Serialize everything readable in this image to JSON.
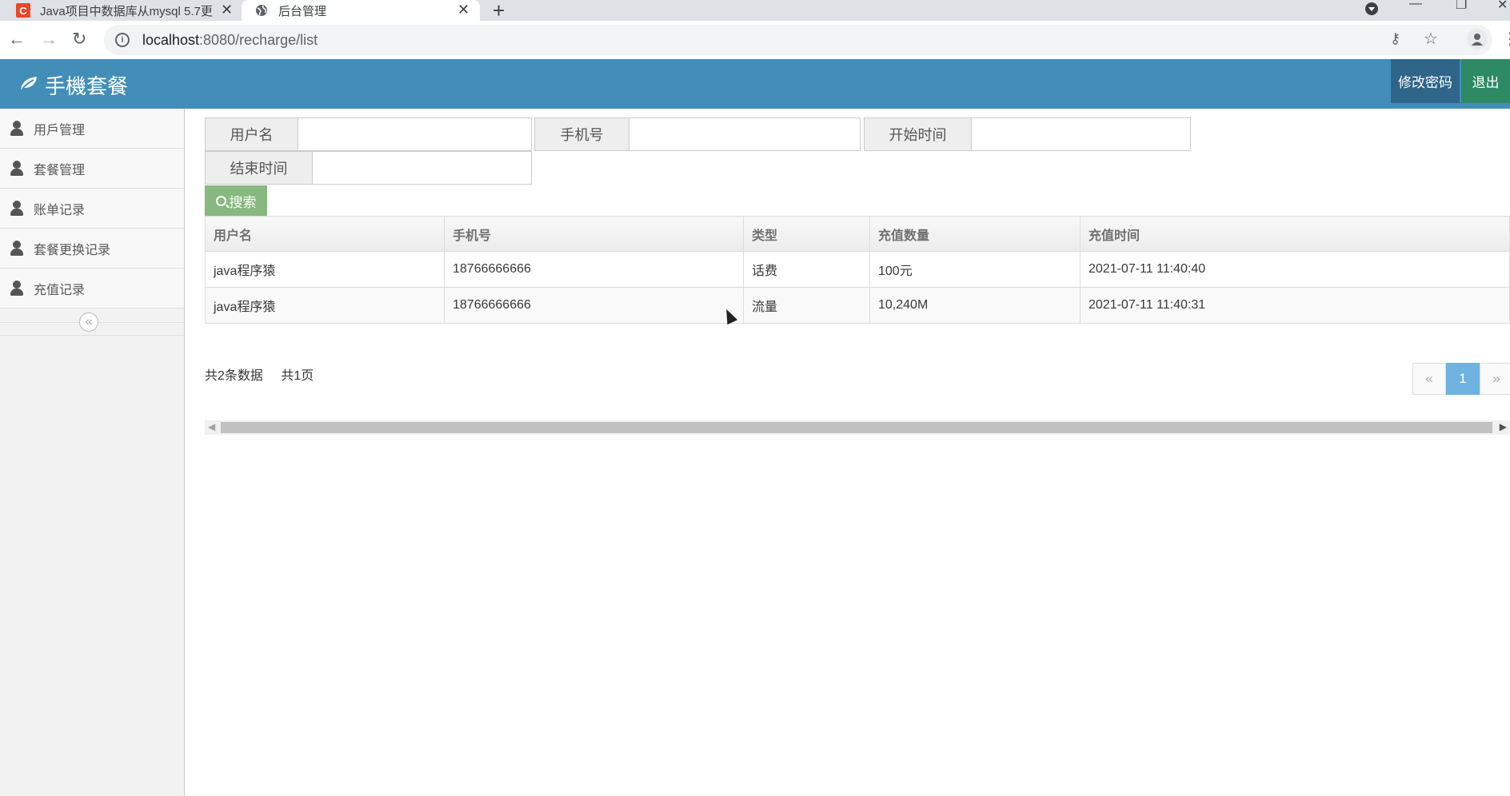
{
  "browser": {
    "tabs": [
      {
        "title": "Java项目中数据库从mysql 5.7更",
        "favicon": "C"
      },
      {
        "title": "后台管理"
      }
    ],
    "url_host": "localhost",
    "url_path": ":8080/recharge/list"
  },
  "header": {
    "title": "手機套餐",
    "change_password": "修改密码",
    "logout": "退出"
  },
  "sidebar": {
    "items": [
      {
        "label": "用戶管理"
      },
      {
        "label": "套餐管理"
      },
      {
        "label": "账单记录"
      },
      {
        "label": "套餐更换记录"
      },
      {
        "label": "充值记录"
      }
    ],
    "collapse_glyph": "«"
  },
  "search": {
    "username_label": "用户名",
    "username_value": "",
    "phone_label": "手机号",
    "phone_value": "",
    "start_label": "开始时间",
    "start_value": "",
    "end_label": "结束时间",
    "end_value": "",
    "button": "搜索"
  },
  "table": {
    "headers": [
      "用户名",
      "手机号",
      "类型",
      "充值数量",
      "充值时间"
    ],
    "rows": [
      [
        "java程序猿",
        "18766666666",
        "话费",
        "100元",
        "2021-07-11 11:40:40"
      ],
      [
        "java程序猿",
        "18766666666",
        "流量",
        "10,240M",
        "2021-07-11 11:40:31"
      ]
    ]
  },
  "footer": {
    "total_records": "共2条数据",
    "total_pages": "共1页",
    "pager": {
      "prev": "«",
      "current": "1",
      "next": "»"
    }
  },
  "colors": {
    "header_bg": "#438eb9",
    "change_password_bg": "#2e6589",
    "logout_bg": "#2e8965",
    "search_button_bg": "#87b87f",
    "pager_active_bg": "#6fb3e0"
  }
}
